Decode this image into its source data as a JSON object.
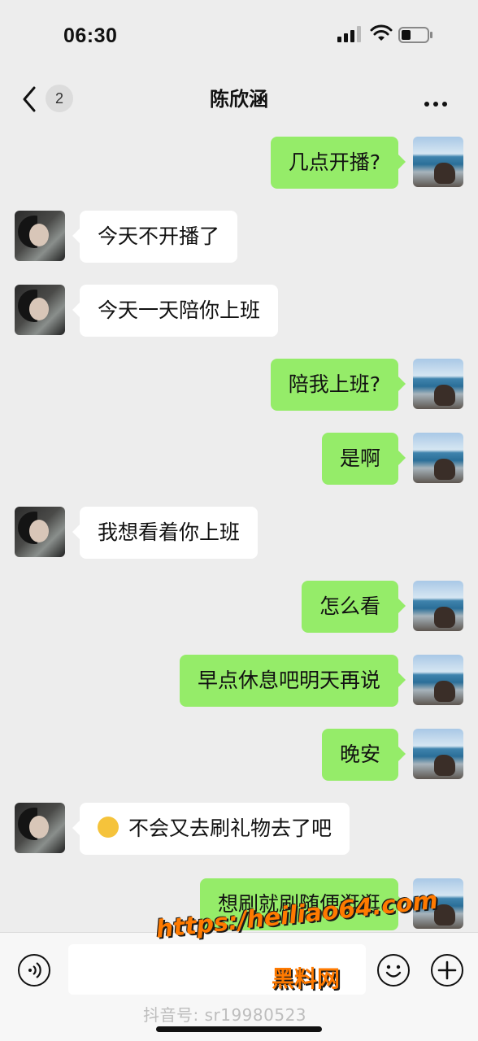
{
  "status_bar": {
    "time": "06:30"
  },
  "header": {
    "back_badge": "2",
    "title": "陈欣涵"
  },
  "messages": [
    {
      "side": "right",
      "text": "几点开播?"
    },
    {
      "side": "left",
      "text": "今天不开播了"
    },
    {
      "side": "left",
      "text": "今天一天陪你上班"
    },
    {
      "side": "right",
      "text": "陪我上班?"
    },
    {
      "side": "right",
      "text": "是啊"
    },
    {
      "side": "left",
      "text": "我想看着你上班"
    },
    {
      "side": "right",
      "text": "怎么看"
    },
    {
      "side": "right",
      "text": "早点休息吧明天再说"
    },
    {
      "side": "right",
      "text": "晚安"
    },
    {
      "side": "left",
      "text": "不会又去刷礼物去了吧",
      "emoji": "thinking-face"
    },
    {
      "side": "right",
      "text": "想刷就刷随便逛逛"
    }
  ],
  "watermark": {
    "url": "https:/heiliao64.com",
    "site": "黑料网",
    "douyin": "抖音号: sr19980523"
  },
  "colors": {
    "bubble_self": "#95ec69",
    "bubble_other": "#ffffff",
    "background": "#ededed"
  }
}
